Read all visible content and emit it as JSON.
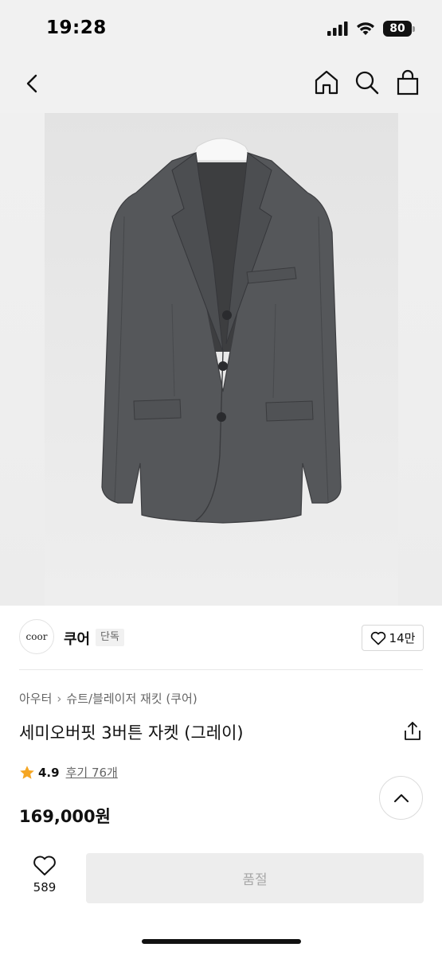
{
  "status_bar": {
    "time": "19:28",
    "battery": "80",
    "icons": [
      "signal-icon",
      "wifi-icon",
      "battery-icon"
    ]
  },
  "nav": {
    "icons": [
      "back-icon",
      "home-icon",
      "search-icon",
      "shopping-bag-icon"
    ]
  },
  "hero": {
    "image": "gray three-button blazer on hanger"
  },
  "brand": {
    "logo_text": "coor",
    "name": "쿠어",
    "badge": "단독",
    "likes": "14만"
  },
  "breadcrumb": {
    "items": [
      "아우터",
      "슈트/블레이저 재킷 (쿠어)"
    ]
  },
  "product": {
    "title": "세미오버핏 3버튼 자켓 (그레이)",
    "rating": "4.9",
    "review_link": "후기 76개",
    "price": "169,000원"
  },
  "bottom_bar": {
    "wish_count": "589",
    "soldout_label": "품절"
  },
  "colors": {
    "star": "#f5a623",
    "background": "#ffffff",
    "header_bg": "#f1f1f1",
    "disabled_button": "#ededed"
  }
}
